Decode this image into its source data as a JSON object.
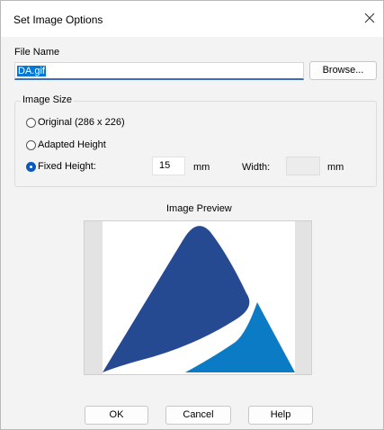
{
  "window": {
    "title": "Set Image Options"
  },
  "file": {
    "label": "File Name",
    "value": "DA.gif",
    "browse_label": "Browse..."
  },
  "image_size": {
    "group_label": "Image Size",
    "options": [
      {
        "label": "Original (286 x 226)",
        "selected": false
      },
      {
        "label": "Adapted Height",
        "selected": false
      },
      {
        "label": "Fixed Height:",
        "selected": true
      }
    ],
    "height_value": "15",
    "height_unit": "mm",
    "width_label": "Width:",
    "width_value": "",
    "width_unit": "mm"
  },
  "preview": {
    "label": "Image Preview"
  },
  "buttons": {
    "ok": "OK",
    "cancel": "Cancel",
    "help": "Help"
  },
  "colors": {
    "logo_dark": "#264a91",
    "logo_light": "#0a7bc4",
    "accent": "#0a58c4"
  },
  "icons": {
    "close": "close-icon"
  }
}
